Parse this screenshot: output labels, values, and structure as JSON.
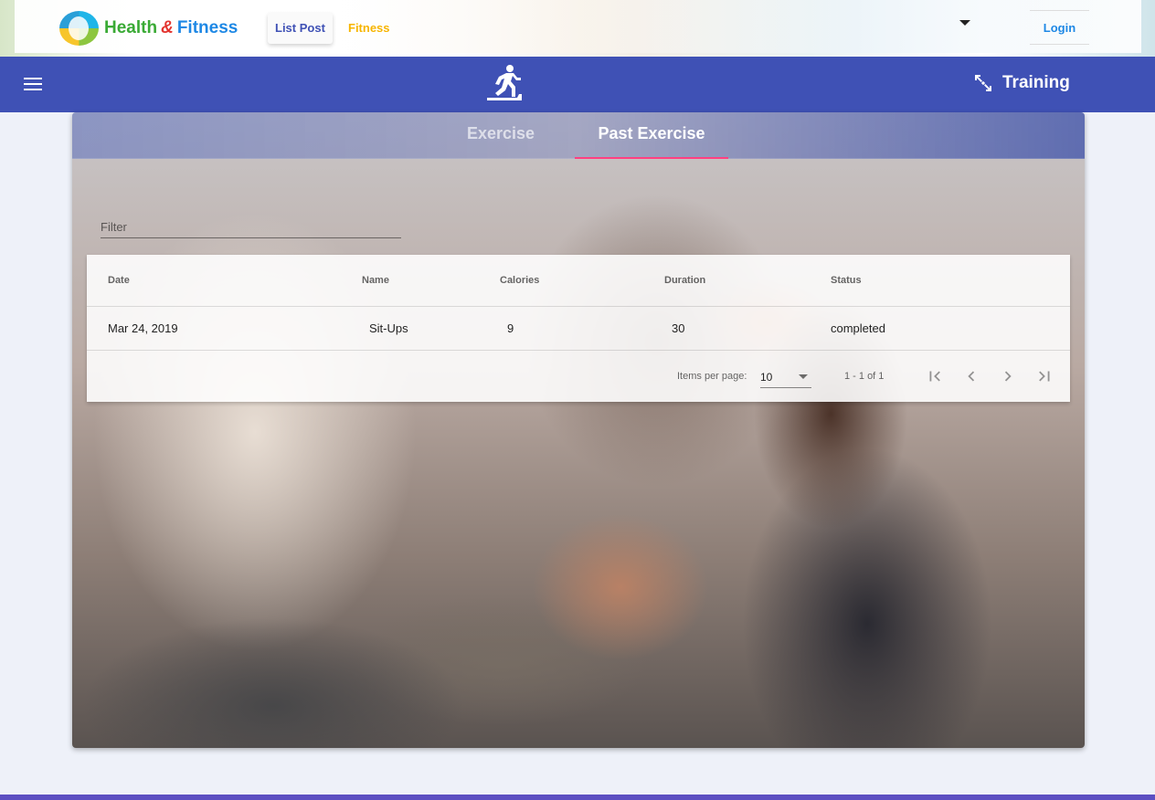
{
  "site": {
    "brand_word1": "Health",
    "brand_amp": "&",
    "brand_word2": "Fitness",
    "nav": {
      "list_post": "List Post",
      "fitness": "Fitness"
    },
    "login": "Login"
  },
  "toolbar": {
    "training": "Training",
    "menu_icon": "menu-icon",
    "center_icon": "treadmill-icon",
    "training_icon": "fitness-icon",
    "color": "#3f51b5"
  },
  "tabs": [
    {
      "label": "Exercise",
      "active": false
    },
    {
      "label": "Past Exercise",
      "active": true
    }
  ],
  "filter": {
    "placeholder": "Filter",
    "value": ""
  },
  "table": {
    "columns": [
      "Date",
      "Name",
      "Calories",
      "Duration",
      "Status"
    ],
    "rows": [
      {
        "date": "Mar 24, 2019",
        "name": "Sit-Ups",
        "calories": "9",
        "duration": "30",
        "status": "completed"
      }
    ]
  },
  "paginator": {
    "items_per_page_label": "Items per page:",
    "items_per_page": "10",
    "range": "1 - 1 of 1"
  },
  "colors": {
    "accent": "#ff4081",
    "primary": "#3f51b5",
    "footer": "#5c4fc2"
  }
}
